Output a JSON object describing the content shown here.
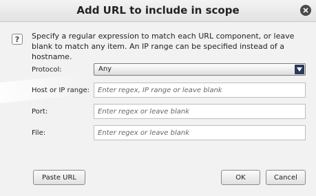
{
  "dialog": {
    "title": "Add URL to include in scope",
    "description": "Specify a regular expression to match each URL component, or leave blank to match any item. An IP range can be specified instead of a hostname.",
    "help_glyph": "?"
  },
  "form": {
    "protocol_label": "Protocol:",
    "protocol_value": "Any",
    "host_label": "Host or IP range:",
    "host_placeholder": "Enter regex, IP range or leave blank",
    "port_label": "Port:",
    "port_placeholder": "Enter regex or leave blank",
    "file_label": "File:",
    "file_placeholder": "Enter regex or leave blank"
  },
  "buttons": {
    "paste_url": "Paste URL",
    "ok": "OK",
    "cancel": "Cancel"
  },
  "icons": {
    "close": "close-icon",
    "help": "help-icon",
    "dropdown": "chevron-down-icon"
  }
}
